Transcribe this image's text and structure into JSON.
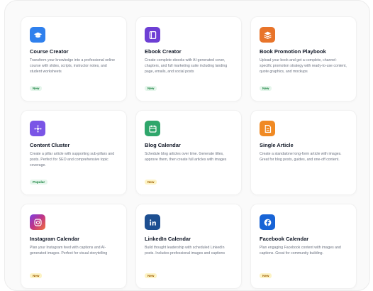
{
  "colors": {
    "course": "#2f80ed",
    "ebook": "#6d3fd4",
    "promo": "#e8742a",
    "cluster": "#7a55e6",
    "blog": "#2fa66b",
    "article": "#f08a24",
    "instagram": "#c13584",
    "linkedin": "#1d4f91",
    "facebook": "#1864d6"
  },
  "cards": [
    {
      "icon": "graduation-cap-icon",
      "title": "Course Creator",
      "description": "Transform your knowledge into a professional online course with slides, scripts, instructor notes, and student worksheets",
      "badge": "New",
      "badge_style": "green"
    },
    {
      "icon": "book-icon",
      "title": "Ebook Creator",
      "description": "Create complete ebooks with AI-generated cover, chapters, and full marketing suite including landing page, emails, and social posts",
      "badge": "New",
      "badge_style": "green"
    },
    {
      "icon": "stack-layers-icon",
      "title": "Book Promotion Playbook",
      "description": "Upload your book and get a complete, channel-specific promotion strategy with ready-to-use content, quote graphics, and mockups",
      "badge": "New",
      "badge_style": "green"
    },
    {
      "icon": "network-cluster-icon",
      "title": "Content Cluster",
      "description": "Create a pillar article with supporting sub-pillars and posts. Perfect for SEO and comprehensive topic coverage.",
      "badge": "Popular",
      "badge_style": "green"
    },
    {
      "icon": "calendar-icon",
      "title": "Blog Calendar",
      "description": "Schedule blog articles over time. Generate titles, approve them, then create full articles with images",
      "badge": "New",
      "badge_style": "yellow"
    },
    {
      "icon": "document-icon",
      "title": "Single Article",
      "description": "Create a standalone long-form article with images. Great for blog posts, guides, and one-off content.",
      "badge": "",
      "badge_style": ""
    },
    {
      "icon": "instagram-icon",
      "title": "Instagram Calendar",
      "description": "Plan your Instagram feed with captions and AI-generated images. Perfect for visual storytelling",
      "badge": "New",
      "badge_style": "yellow"
    },
    {
      "icon": "linkedin-icon",
      "title": "LinkedIn Calendar",
      "description": "Build thought leadership with scheduled LinkedIn posts. Includes professional images and captions",
      "badge": "New",
      "badge_style": "yellow"
    },
    {
      "icon": "facebook-icon",
      "title": "Facebook Calendar",
      "description": "Plan engaging Facebook content with images and captions. Great for community building.",
      "badge": "New",
      "badge_style": "yellow"
    }
  ]
}
